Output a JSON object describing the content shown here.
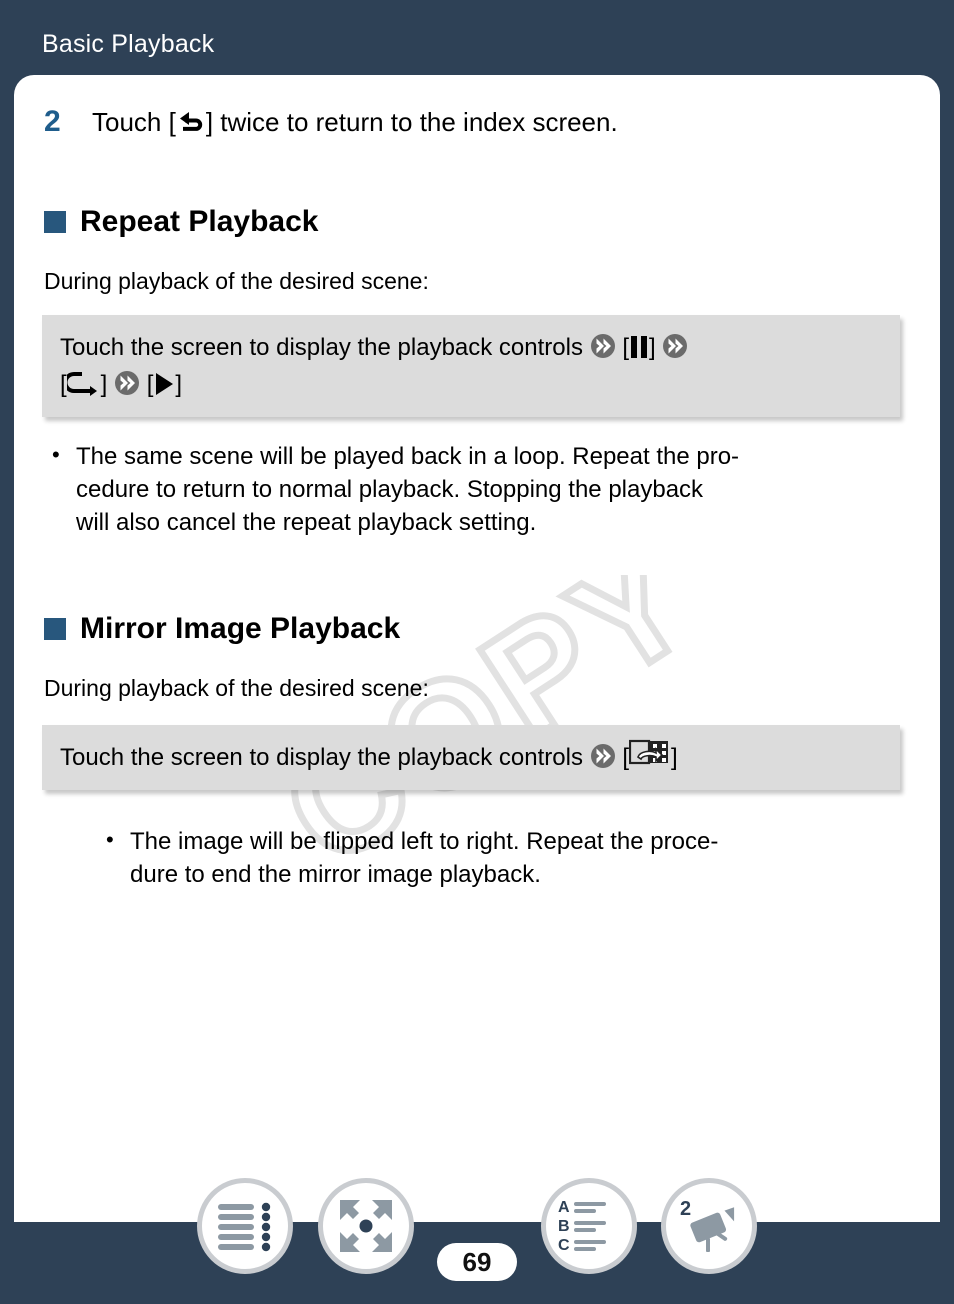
{
  "header": {
    "title": "Basic Playback",
    "bg_color": "#2e4156"
  },
  "step": {
    "number": "2",
    "text_before": "Touch [",
    "icon": "return-arrow-icon",
    "text_after": "] twice to return to the index screen."
  },
  "sections": [
    {
      "id": "repeat-playback",
      "title": "Repeat Playback",
      "lead": "During playback of the desired scene:",
      "command_line1_text": "Touch the screen to display the playback controls",
      "command_icons_line1": [
        "chevron-icon",
        "pause-icon",
        "chevron-icon"
      ],
      "command_icons_line2": [
        "repeat-loop-icon",
        "chevron-icon",
        "play-icon"
      ],
      "bullets": [
        "The same scene will be played back in a loop. Repeat the pro-",
        "cedure to return to normal playback. Stopping the playback",
        "will also cancel the repeat playback setting."
      ]
    },
    {
      "id": "mirror-image-playback",
      "title": "Mirror Image Playback",
      "lead": "During playback of the desired scene:",
      "command_line1_text": "Touch the screen to display the playback controls",
      "command_icons_line1": [
        "chevron-icon",
        "mirror-image-icon"
      ],
      "bullets": [
        "The image will be flipped left to right. Repeat the proce-",
        "dure to end the mirror image playback."
      ]
    }
  ],
  "watermark": {
    "text": "COPY"
  },
  "bottom_nav": {
    "page_number": "69",
    "items": [
      {
        "name": "toc-list-icon",
        "label": "Table of Contents"
      },
      {
        "name": "expand-arrows-icon",
        "label": "Quick Reference"
      },
      {
        "name": "abc-index-icon",
        "label": "Alphabetical Index"
      },
      {
        "name": "camcorder-2-icon",
        "label": "Camcorder 2"
      }
    ]
  },
  "colors": {
    "page_bg": "#2e4156",
    "accent_blue": "#1f5d8c",
    "square_blue": "#28577d",
    "command_box": "#dcdcdc",
    "chevron_gray": "#6b6b6b"
  }
}
